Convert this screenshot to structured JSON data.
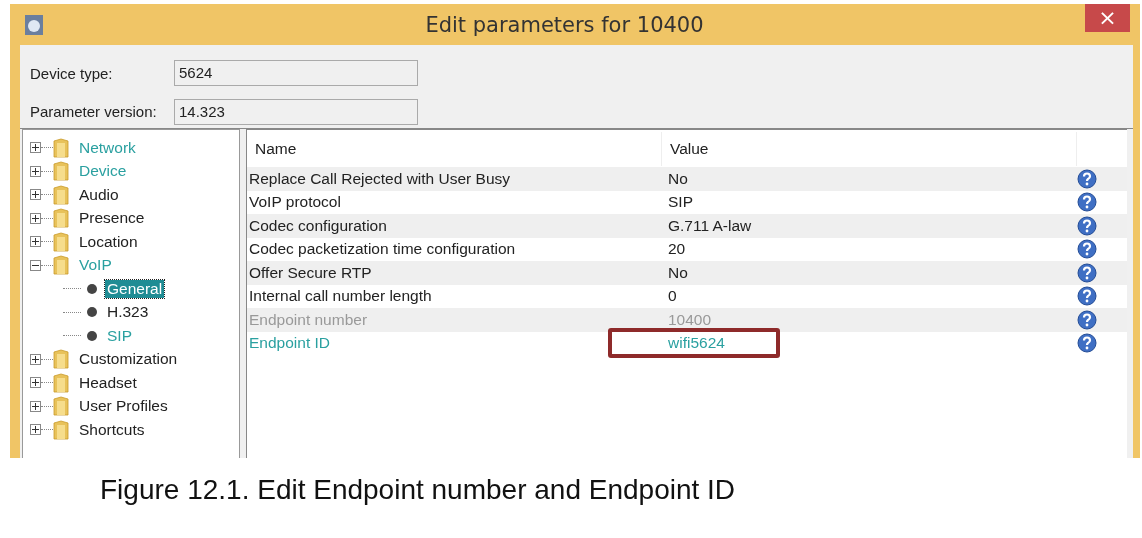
{
  "window": {
    "title": "Edit parameters for 10400",
    "close": "×"
  },
  "fields": [
    {
      "label": "Device type:",
      "value": "5624"
    },
    {
      "label": "Parameter version:",
      "value": "14.323"
    }
  ],
  "tree": [
    {
      "label": "Network",
      "modified": true,
      "expanded": false,
      "selected": false
    },
    {
      "label": "Device",
      "modified": true,
      "expanded": false,
      "selected": false
    },
    {
      "label": "Audio",
      "modified": false,
      "expanded": false,
      "selected": false
    },
    {
      "label": "Presence",
      "modified": false,
      "expanded": false,
      "selected": false
    },
    {
      "label": "Location",
      "modified": false,
      "expanded": false,
      "selected": false
    },
    {
      "label": "VoIP",
      "modified": true,
      "expanded": true,
      "selected": false,
      "children": [
        {
          "label": "General",
          "modified": true,
          "selected": true
        },
        {
          "label": "H.323",
          "modified": false,
          "selected": false
        },
        {
          "label": "SIP",
          "modified": true,
          "selected": false
        }
      ]
    },
    {
      "label": "Customization",
      "modified": false,
      "expanded": false,
      "selected": false
    },
    {
      "label": "Headset",
      "modified": false,
      "expanded": false,
      "selected": false
    },
    {
      "label": "User Profiles",
      "modified": false,
      "expanded": false,
      "selected": false
    },
    {
      "label": "Shortcuts",
      "modified": false,
      "expanded": false,
      "selected": false
    }
  ],
  "table": {
    "columns": [
      "Name",
      "Value"
    ],
    "rows": [
      {
        "name": "Replace Call Rejected with User Busy",
        "value": "No",
        "kind": "normal",
        "annotated": false
      },
      {
        "name": "VoIP protocol",
        "value": "SIP",
        "kind": "normal",
        "annotated": false
      },
      {
        "name": "Codec configuration",
        "value": "G.711 A-law",
        "kind": "normal",
        "annotated": false
      },
      {
        "name": "Codec packetization time configuration",
        "value": "20",
        "kind": "normal",
        "annotated": false
      },
      {
        "name": "Offer Secure RTP",
        "value": "No",
        "kind": "normal",
        "annotated": false
      },
      {
        "name": "Internal call number length",
        "value": "0",
        "kind": "normal",
        "annotated": false
      },
      {
        "name": "Endpoint number",
        "value": "10400",
        "kind": "disabled",
        "annotated": false
      },
      {
        "name": "Endpoint ID",
        "value": "wifi5624",
        "kind": "modified",
        "annotated": true
      }
    ]
  },
  "caption": "Figure 12.1. Edit Endpoint number and Endpoint ID"
}
